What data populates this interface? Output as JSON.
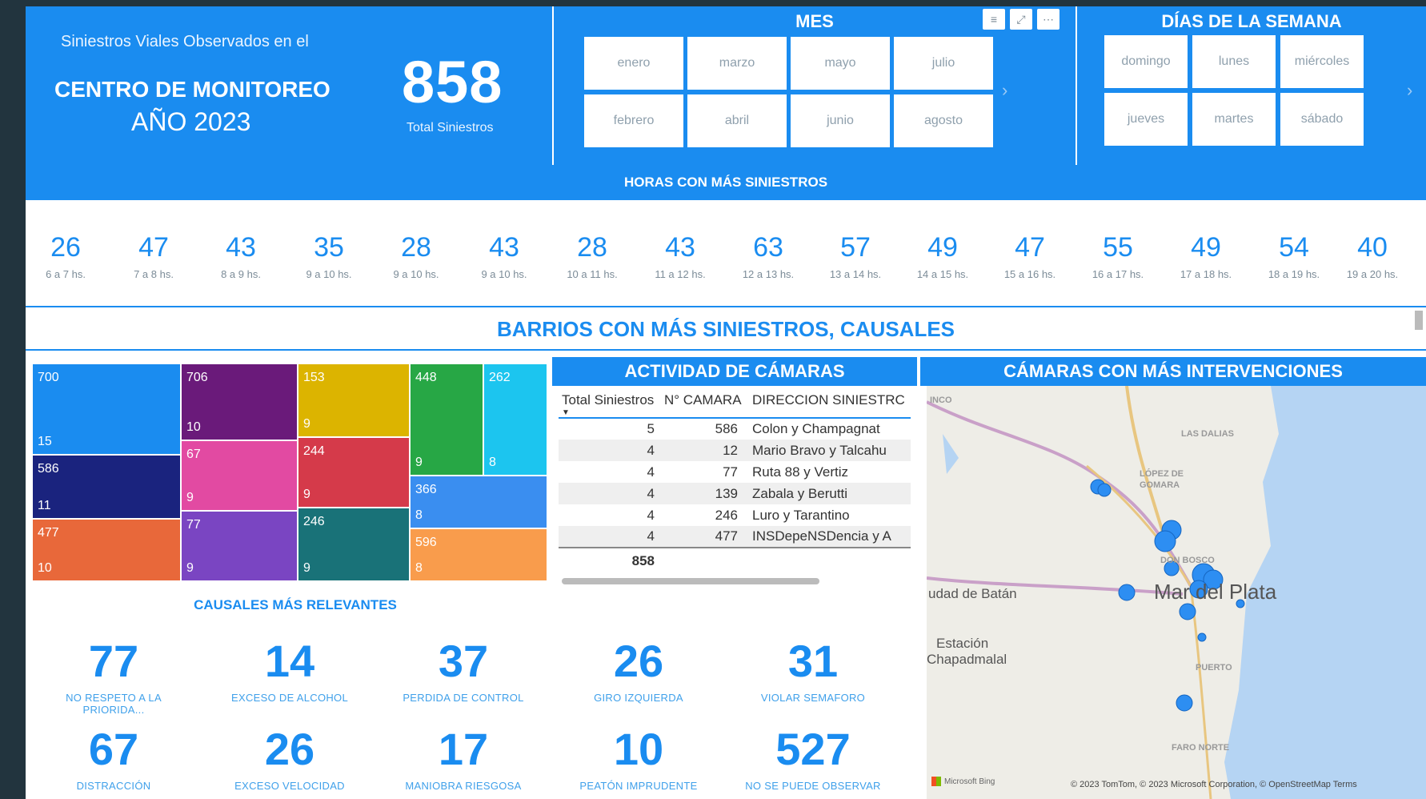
{
  "title": {
    "line1": "Siniestros Viales Observados en el",
    "line2": "CENTRO DE MONITOREO",
    "line3": "AÑO 2023",
    "kpi_value": "858",
    "kpi_label": "Total Siniestros"
  },
  "mes": {
    "heading": "MES",
    "icons": [
      "filter-icon",
      "focus-icon",
      "more-icon"
    ],
    "months": [
      "enero",
      "marzo",
      "mayo",
      "julio",
      "febrero",
      "abril",
      "junio",
      "agosto"
    ]
  },
  "dias": {
    "heading": "DÍAS DE LA SEMANA",
    "days": [
      "domingo",
      "lunes",
      "miércoles",
      "jueves",
      "martes",
      "sábado"
    ]
  },
  "horas": {
    "heading": "HORAS CON MÁS SINIESTROS",
    "items": [
      {
        "value": "26",
        "label": "6 a 7 hs."
      },
      {
        "value": "47",
        "label": "7 a 8 hs."
      },
      {
        "value": "43",
        "label": "8 a 9 hs."
      },
      {
        "value": "35",
        "label": "9 a 10 hs."
      },
      {
        "value": "28",
        "label": "9 a 10 hs."
      },
      {
        "value": "43",
        "label": "9 a 10 hs."
      },
      {
        "value": "28",
        "label": "10 a 11 hs."
      },
      {
        "value": "43",
        "label": "11 a 12 hs."
      },
      {
        "value": "63",
        "label": "12 a 13 hs."
      },
      {
        "value": "57",
        "label": "13 a 14 hs."
      },
      {
        "value": "49",
        "label": "14 a 15 hs."
      },
      {
        "value": "47",
        "label": "15 a 16 hs."
      },
      {
        "value": "55",
        "label": "16 a 17 hs."
      },
      {
        "value": "49",
        "label": "17 a 18 hs."
      },
      {
        "value": "54",
        "label": "18 a 19 hs."
      },
      {
        "value": "40",
        "label": "19 a 20 hs."
      }
    ]
  },
  "barrios": {
    "heading": "BARRIOS CON MÁS SINIESTROS, CAUSALES",
    "tiles": [
      {
        "top": "700",
        "bottom": "15",
        "color": "#1a8cf0"
      },
      {
        "top": "586",
        "bottom": "11",
        "color": "#1a237e"
      },
      {
        "top": "477",
        "bottom": "10",
        "color": "#e8683a"
      },
      {
        "top": "706",
        "bottom": "10",
        "color": "#6a1a7a"
      },
      {
        "top": "67",
        "bottom": "9",
        "color": "#e24aa2"
      },
      {
        "top": "77",
        "bottom": "9",
        "color": "#7a45c2"
      },
      {
        "top": "153",
        "bottom": "9",
        "color": "#dcb400"
      },
      {
        "top": "244",
        "bottom": "9",
        "color": "#d53a4a"
      },
      {
        "top": "246",
        "bottom": "9",
        "color": "#197278"
      },
      {
        "top": "448",
        "bottom": "9",
        "color": "#27a745"
      },
      {
        "top": "262",
        "bottom": "8",
        "color": "#1cc5ef"
      },
      {
        "top": "366",
        "bottom": "8",
        "color": "#3a8ef0"
      },
      {
        "top": "596",
        "bottom": "8",
        "color": "#f99c4c"
      }
    ]
  },
  "actividad": {
    "heading": "ACTIVIDAD DE CÁMARAS",
    "columns": [
      "Total Siniestros",
      "N° CAMARA",
      "DIRECCION SINIESTRC"
    ],
    "rows": [
      [
        "5",
        "586",
        "Colon y Champagnat"
      ],
      [
        "4",
        "12",
        "Mario Bravo y Talcahu"
      ],
      [
        "4",
        "77",
        "Ruta 88 y Vertiz"
      ],
      [
        "4",
        "139",
        "Zabala y Berutti"
      ],
      [
        "4",
        "246",
        "Luro y Tarantino"
      ],
      [
        "4",
        "477",
        "INSDepeNSDencia y A"
      ]
    ],
    "total": "858"
  },
  "camaras": {
    "heading": "CÁMARAS CON MÁS INTERVENCIONES",
    "labels": [
      "INCO",
      "LAS DALIAS",
      "LÓPEZ DE",
      "GOMARA",
      "DON BOSCO",
      "Mar del Plata",
      "udad de Batán",
      "Estación",
      "Chapadmalal",
      "PUERTO",
      "FARO NORTE"
    ],
    "attribution": "© 2023 TomTom, © 2023 Microsoft Corporation, © OpenStreetMap  Terms",
    "bing": "Microsoft Bing"
  },
  "causales": {
    "heading": "CAUSALES MÁS RELEVANTES",
    "items": [
      {
        "value": "77",
        "label": "NO RESPETO A LA PRIORIDA..."
      },
      {
        "value": "14",
        "label": "EXCESO DE ALCOHOL"
      },
      {
        "value": "37",
        "label": "PERDIDA DE CONTROL"
      },
      {
        "value": "26",
        "label": "GIRO IZQUIERDA"
      },
      {
        "value": "31",
        "label": "VIOLAR SEMAFORO"
      },
      {
        "value": "67",
        "label": "DISTRACCIÓN"
      },
      {
        "value": "26",
        "label": "EXCESO VELOCIDAD"
      },
      {
        "value": "17",
        "label": "MANIOBRA RIESGOSA"
      },
      {
        "value": "10",
        "label": "PEATÓN IMPRUDENTE"
      },
      {
        "value": "527",
        "label": "NO SE PUEDE OBSERVAR"
      }
    ]
  }
}
